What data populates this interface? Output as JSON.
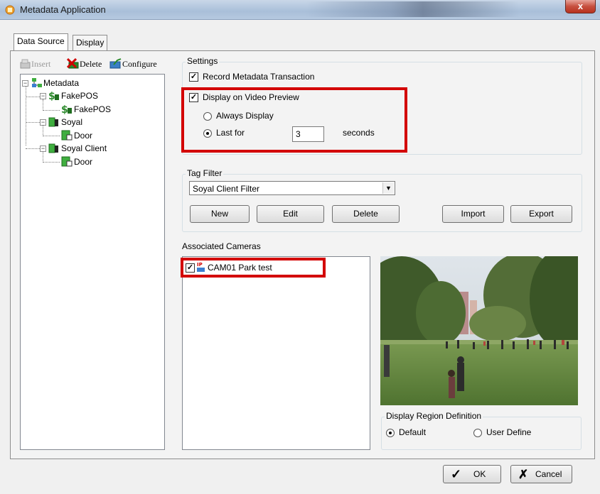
{
  "window": {
    "title": "Metadata Application",
    "close_symbol": "x"
  },
  "tabs": [
    {
      "label": "Data Source"
    },
    {
      "label": "Display"
    }
  ],
  "toolbar": {
    "insert": "Insert",
    "delete": "Delete",
    "configure": "Configure"
  },
  "tree": {
    "root": "Metadata",
    "nodes": [
      {
        "label": "FakePOS",
        "child": "FakePOS"
      },
      {
        "label": "Soyal",
        "child": "Door"
      },
      {
        "label": "Soyal Client",
        "child": "Door"
      }
    ]
  },
  "settings": {
    "title": "Settings",
    "record_transaction": "Record Metadata Transaction",
    "display_on_preview": "Display on Video Preview",
    "always_display": "Always Display",
    "last_for": "Last for",
    "seconds_value": "3",
    "seconds_unit": "seconds"
  },
  "tag_filter": {
    "title": "Tag Filter",
    "selected": "Soyal Client Filter",
    "buttons": {
      "new": "New",
      "edit": "Edit",
      "delete": "Delete",
      "import": "Import",
      "export": "Export"
    }
  },
  "cameras": {
    "title": "Associated Cameras",
    "items": [
      {
        "label": "CAM01 Park test",
        "checked": true
      }
    ]
  },
  "region": {
    "title": "Display Region Definition",
    "default": "Default",
    "user_define": "User Define"
  },
  "footer": {
    "ok": "OK",
    "cancel": "Cancel"
  },
  "colors": {
    "highlight_red": "#d30000",
    "tree_green": "#2e8b2e"
  }
}
